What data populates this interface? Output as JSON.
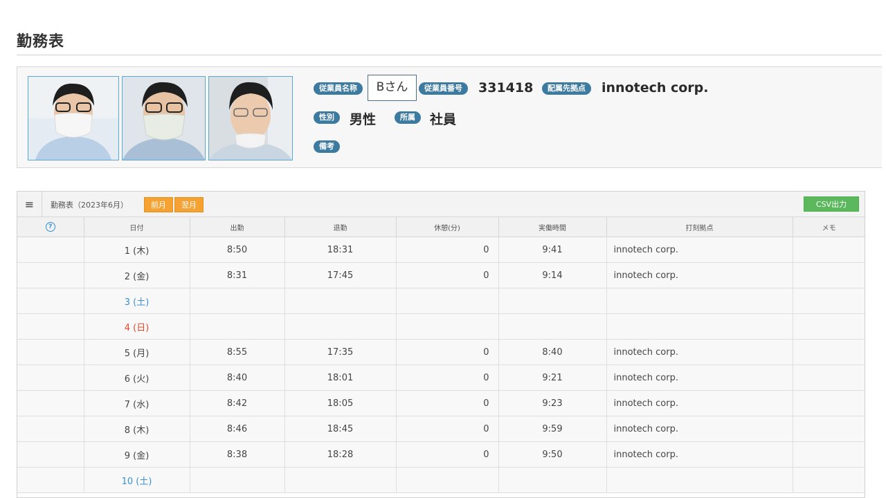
{
  "page_title": "勤務表",
  "employee": {
    "name_label": "従業員名称",
    "name_value": "Bさん",
    "number_label": "従業員番号",
    "number_value": "331418",
    "location_label": "配属先拠点",
    "location_value": "innotech corp.",
    "gender_label": "性別",
    "gender_value": "男性",
    "affiliation_label": "所属",
    "affiliation_value": "社員",
    "remarks_label": "備考"
  },
  "timesheet": {
    "title": "勤務表（2023年6月）",
    "prev_label": "前月",
    "next_label": "翌月",
    "csv_label": "CSV出力",
    "columns": [
      "日付",
      "出勤",
      "退勤",
      "休憩(分)",
      "実働時間",
      "打刻拠点",
      "メモ"
    ],
    "rows": [
      {
        "date": "1 (木)",
        "in": "8:50",
        "out": "18:31",
        "break": "0",
        "work": "9:41",
        "loc": "innotech corp.",
        "memo": "",
        "day": "weekday"
      },
      {
        "date": "2 (金)",
        "in": "8:31",
        "out": "17:45",
        "break": "0",
        "work": "9:14",
        "loc": "innotech corp.",
        "memo": "",
        "day": "weekday"
      },
      {
        "date": "3 (土)",
        "in": "",
        "out": "",
        "break": "",
        "work": "",
        "loc": "",
        "memo": "",
        "day": "sat"
      },
      {
        "date": "4 (日)",
        "in": "",
        "out": "",
        "break": "",
        "work": "",
        "loc": "",
        "memo": "",
        "day": "sun"
      },
      {
        "date": "5 (月)",
        "in": "8:55",
        "out": "17:35",
        "break": "0",
        "work": "8:40",
        "loc": "innotech corp.",
        "memo": "",
        "day": "weekday"
      },
      {
        "date": "6 (火)",
        "in": "8:40",
        "out": "18:01",
        "break": "0",
        "work": "9:21",
        "loc": "innotech corp.",
        "memo": "",
        "day": "weekday"
      },
      {
        "date": "7 (水)",
        "in": "8:42",
        "out": "18:05",
        "break": "0",
        "work": "9:23",
        "loc": "innotech corp.",
        "memo": "",
        "day": "weekday"
      },
      {
        "date": "8 (木)",
        "in": "8:46",
        "out": "18:45",
        "break": "0",
        "work": "9:59",
        "loc": "innotech corp.",
        "memo": "",
        "day": "weekday"
      },
      {
        "date": "9 (金)",
        "in": "8:38",
        "out": "18:28",
        "break": "0",
        "work": "9:50",
        "loc": "innotech corp.",
        "memo": "",
        "day": "weekday"
      },
      {
        "date": "10 (土)",
        "in": "",
        "out": "",
        "break": "",
        "work": "",
        "loc": "",
        "memo": "",
        "day": "sat"
      }
    ]
  },
  "icons": {
    "menu": "hamburger-icon",
    "help": "question-circle-icon"
  },
  "colors": {
    "badge": "#3d7aa0",
    "orange_button": "#f5a233",
    "green_button": "#5cb85c",
    "saturday": "#3a8fd6",
    "sunday": "#e04a2e"
  }
}
